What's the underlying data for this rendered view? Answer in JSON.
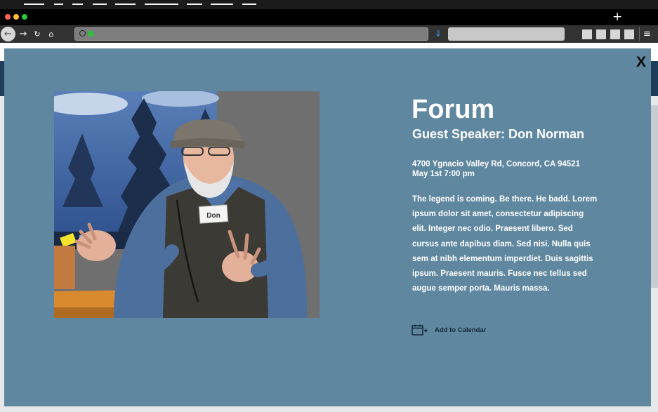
{
  "browser": {
    "new_tab": "+",
    "menu": "≡"
  },
  "modal": {
    "close_label": "X",
    "title": "Forum",
    "subtitle": "Guest Speaker: Don Norman",
    "address": "4700 Ygnacio Valley Rd, Concord, CA 94521",
    "datetime": "May 1st 7:00 pm",
    "description": "The legend is coming. Be there. He badd. Lorem ipsum dolor sit amet, consectetur adipiscing elit. Integer nec odio. Praesent libero. Sed cursus ante dapibus diam. Sed nisi. Nulla quis sem at nibh elementum imperdiet. Duis sagittis ipsum. Praesent mauris. Fusce nec tellus sed augue semper porta. Mauris massa.",
    "name_badge": "Don",
    "add_to_calendar": "Add to Calendar"
  },
  "colors": {
    "modal_bg": "#5f87a0",
    "text": "#ffffff",
    "link": "#16263a"
  },
  "icons": {
    "close": "close-icon",
    "calendar_add": "calendar-add-icon"
  }
}
